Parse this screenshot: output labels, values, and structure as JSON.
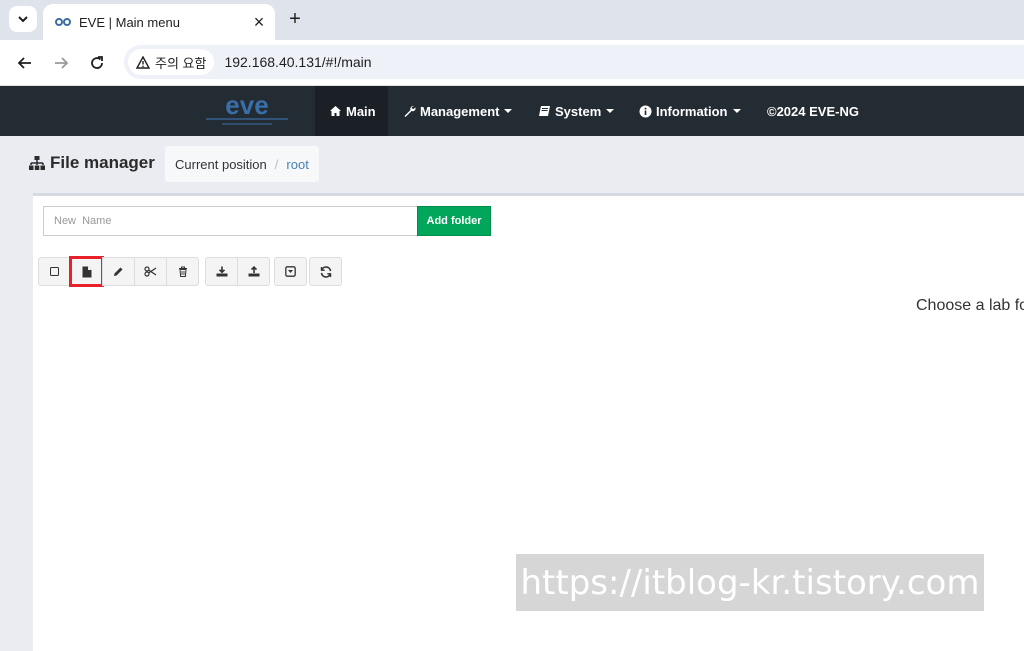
{
  "browser": {
    "tab_title": "EVE | Main menu",
    "close_glyph": "×",
    "new_tab_glyph": "+",
    "security_label": "주의 요함",
    "url": "192.168.40.131/#!/main"
  },
  "navbar": {
    "items": [
      {
        "label": "Main",
        "icon": "home-icon"
      },
      {
        "label": "Management",
        "icon": "wrench-icon"
      },
      {
        "label": "System",
        "icon": "book-icon"
      },
      {
        "label": "Information",
        "icon": "info-icon"
      },
      {
        "label": "©2024 EVE-NG",
        "icon": ""
      }
    ]
  },
  "header": {
    "title": "File manager",
    "breadcrumb_current": "Current position",
    "breadcrumb_sep": "/",
    "breadcrumb_root": "root"
  },
  "folder_form": {
    "placeholder": "New  Name",
    "add_label": "Add folder"
  },
  "toolbar_buttons": [
    "select-all-checkbox",
    "new-file-icon",
    "rename-pencil-icon",
    "cut-scissors-icon",
    "delete-trash-icon",
    "export-download-icon",
    "import-upload-icon",
    "collapse-icon",
    "refresh-icon"
  ],
  "main": {
    "message": "Choose a lab fo"
  },
  "watermark": {
    "text": "https://itblog-kr.tistory.com"
  },
  "colors": {
    "navbar_bg": "#242c33",
    "add_folder_green": "#00a65a",
    "highlight_red": "#e8202a",
    "breadcrumb_link": "#4a7fb0"
  }
}
